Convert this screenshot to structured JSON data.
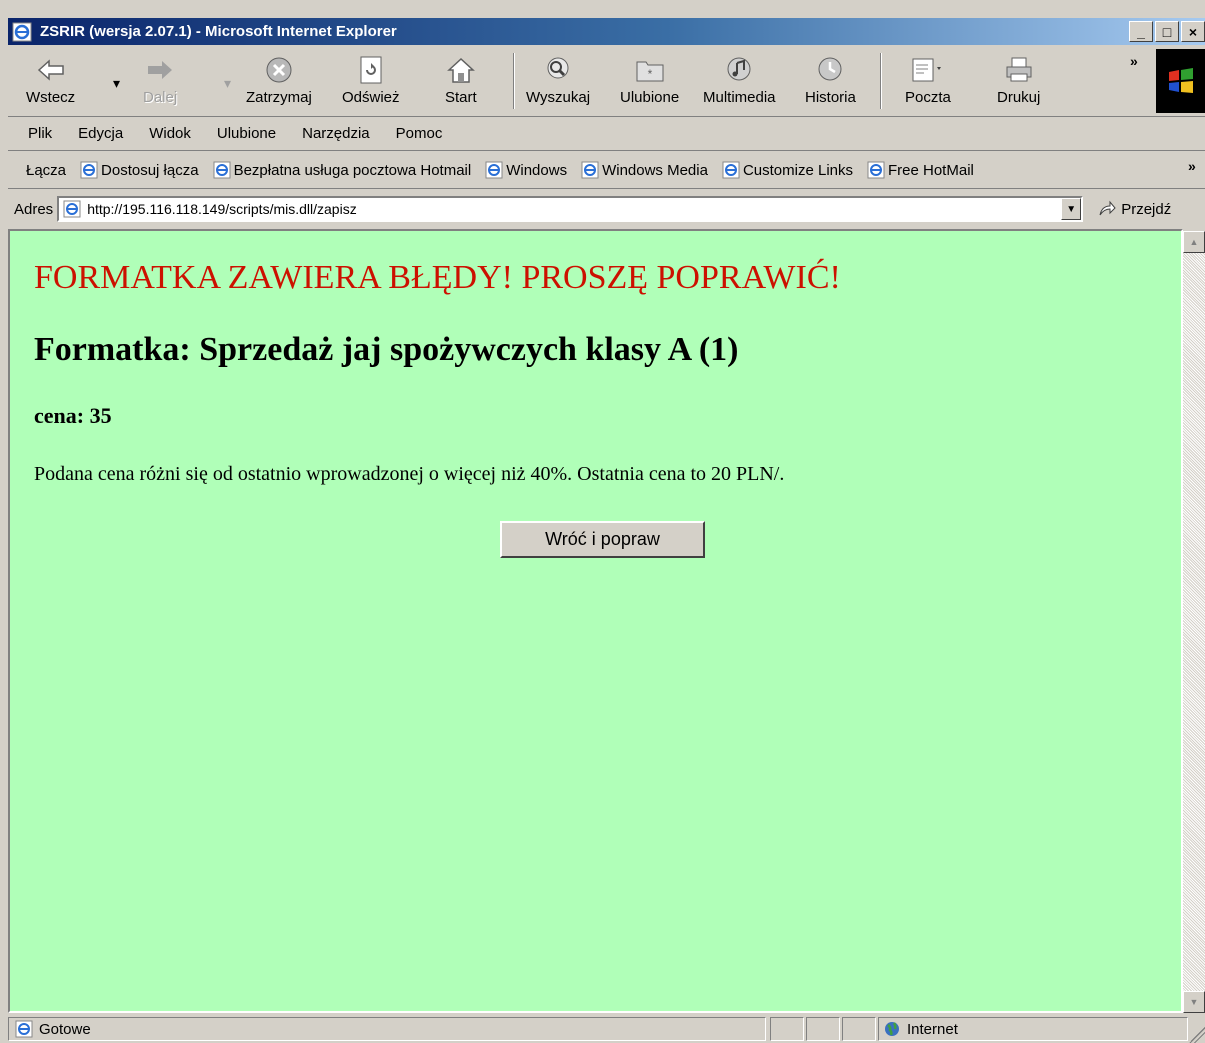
{
  "window": {
    "title": "ZSRIR (wersja 2.07.1) - Microsoft Internet Explorer",
    "minimize": "_",
    "maximize": "□",
    "close": "×"
  },
  "toolbar": {
    "back": "Wstecz",
    "forward": "Dalej",
    "stop": "Zatrzymaj",
    "refresh": "Odśwież",
    "home": "Start",
    "search": "Wyszukaj",
    "favorites": "Ulubione",
    "media": "Multimedia",
    "history": "Historia",
    "mail": "Poczta",
    "print": "Drukuj",
    "more": "»"
  },
  "menu": {
    "file": "Plik",
    "edit": "Edycja",
    "view": "Widok",
    "favorites": "Ulubione",
    "tools": "Narzędzia",
    "help": "Pomoc"
  },
  "links": {
    "label": "Łącza",
    "items": [
      "Dostosuj łącza",
      "Bezpłatna usługa pocztowa Hotmail",
      "Windows",
      "Windows Media",
      "Customize Links",
      "Free HotMail"
    ],
    "more": "»"
  },
  "address": {
    "label": "Adres",
    "url": "http://195.116.118.149/scripts/mis.dll/zapisz",
    "go": "Przejdź"
  },
  "page": {
    "error": "FORMATKA ZAWIERA BŁĘDY! PROSZĘ POPRAWIĆ!",
    "form_title": "Formatka: Sprzedaż jaj spożywczych klasy A (1)",
    "field": "cena: 35",
    "message": "Podana cena różni się od ostatnio wprowadzonej o więcej niż 40%. Ostatnia cena to 20 PLN/.",
    "back_button": "Wróć i popraw"
  },
  "status": {
    "text": "Gotowe",
    "zone": "Internet"
  }
}
